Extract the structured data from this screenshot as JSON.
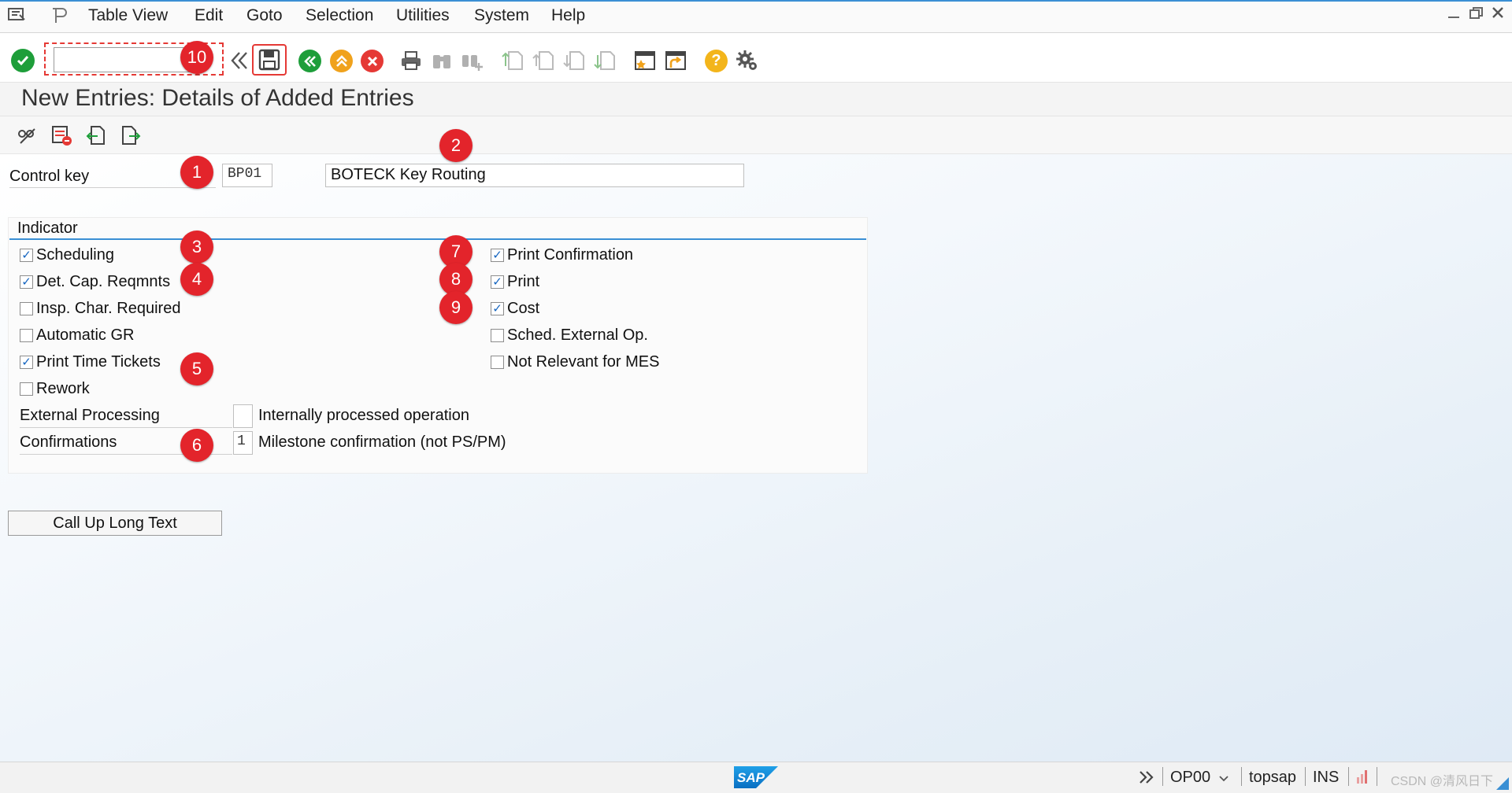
{
  "menu": {
    "items": [
      "Table View",
      "Edit",
      "Goto",
      "Selection",
      "Utilities",
      "System",
      "Help"
    ]
  },
  "toolbar": {
    "command_value": "",
    "annotation_10": "10"
  },
  "page": {
    "title": "New Entries: Details of Added Entries"
  },
  "control_key": {
    "label": "Control key",
    "value": "BP01",
    "description": "BOTECK Key Routing"
  },
  "indicator": {
    "title": "Indicator",
    "left": [
      {
        "label": "Scheduling",
        "checked": true
      },
      {
        "label": "Det. Cap. Reqmnts",
        "checked": true
      },
      {
        "label": "Insp. Char. Required",
        "checked": false
      },
      {
        "label": "Automatic GR",
        "checked": false
      },
      {
        "label": "Print Time Tickets",
        "checked": true
      },
      {
        "label": "Rework",
        "checked": false
      }
    ],
    "right": [
      {
        "label": "Print Confirmation",
        "checked": true
      },
      {
        "label": "Print",
        "checked": true
      },
      {
        "label": "Cost",
        "checked": true
      },
      {
        "label": "Sched. External Op.",
        "checked": false
      },
      {
        "label": "Not Relevant for MES",
        "checked": false
      }
    ],
    "external_processing": {
      "label": "External Processing",
      "value": "",
      "description": "Internally processed operation"
    },
    "confirmations": {
      "label": "Confirmations",
      "value": "1",
      "description": "Milestone confirmation (not PS/PM)"
    }
  },
  "annotations": [
    "1",
    "2",
    "3",
    "4",
    "5",
    "6",
    "7",
    "8",
    "9"
  ],
  "buttons": {
    "long_text": "Call Up Long Text"
  },
  "status": {
    "transaction": "OP00",
    "system": "topsap",
    "mode": "INS",
    "watermark": "CSDN @清风日下",
    "logo": "SAP"
  },
  "colors": {
    "accent": "#3a8fd4",
    "badge": "#e3242b",
    "ok_green": "#1e9e3a",
    "cancel_red": "#e53935",
    "nav_orange": "#f0a21c",
    "help_yellow": "#f3b51b"
  }
}
